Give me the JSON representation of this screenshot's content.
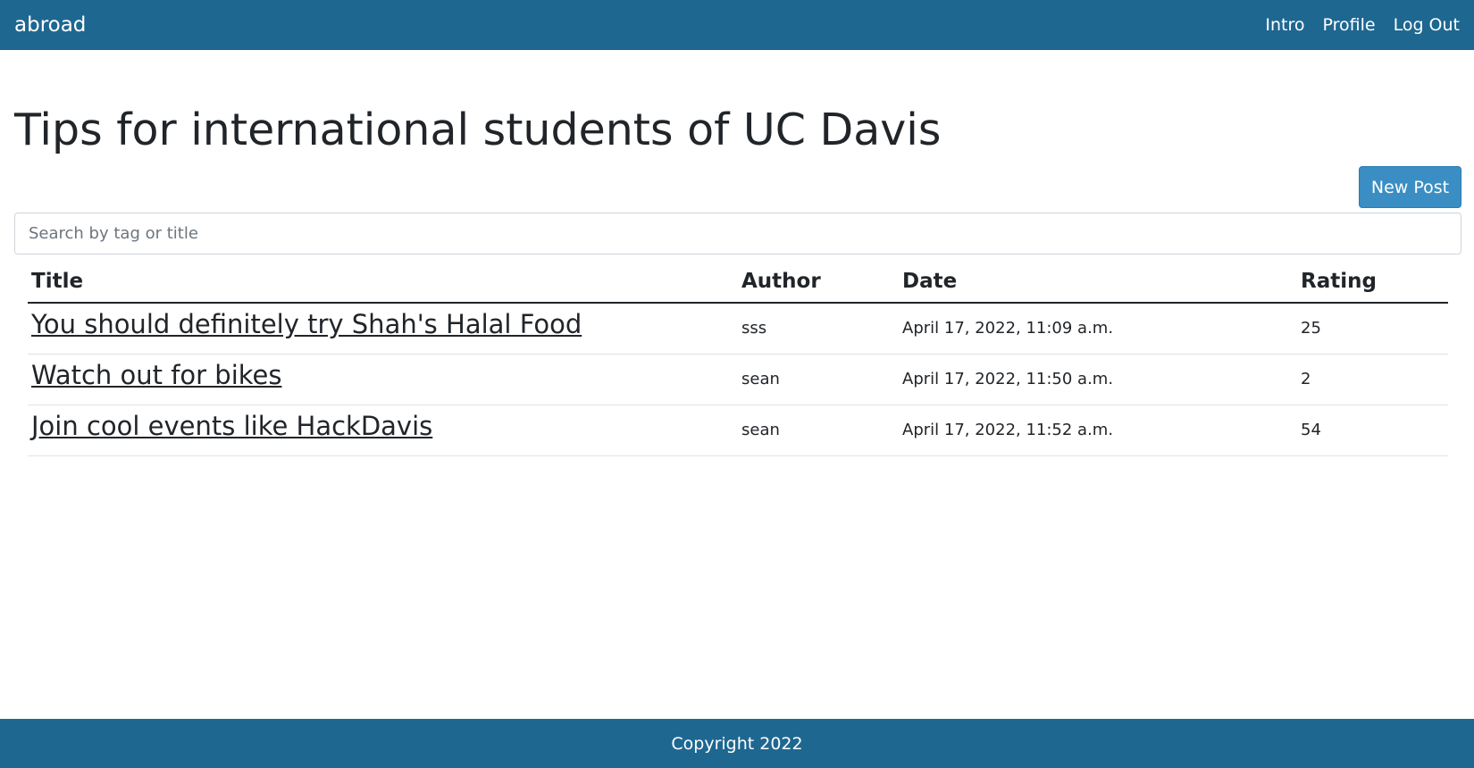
{
  "navbar": {
    "brand": "abroad",
    "links": [
      "Intro",
      "Profile",
      "Log Out"
    ]
  },
  "page_title": "Tips for international students of UC Davis",
  "new_post_label": "New Post",
  "search": {
    "placeholder": "Search by tag or title",
    "value": ""
  },
  "table": {
    "headers": {
      "title": "Title",
      "author": "Author",
      "date": "Date",
      "rating": "Rating"
    },
    "rows": [
      {
        "title": "You should definitely try Shah's Halal Food",
        "author": "sss",
        "date": "April 17, 2022, 11:09 a.m.",
        "rating": "25"
      },
      {
        "title": "Watch out for bikes",
        "author": "sean",
        "date": "April 17, 2022, 11:50 a.m.",
        "rating": "2"
      },
      {
        "title": "Join cool events like HackDavis",
        "author": "sean",
        "date": "April 17, 2022, 11:52 a.m.",
        "rating": "54"
      }
    ]
  },
  "footer": {
    "text": "Copyright 2022"
  },
  "colors": {
    "navbar_bg": "#1e6791",
    "button_bg": "#3a8ec4"
  }
}
